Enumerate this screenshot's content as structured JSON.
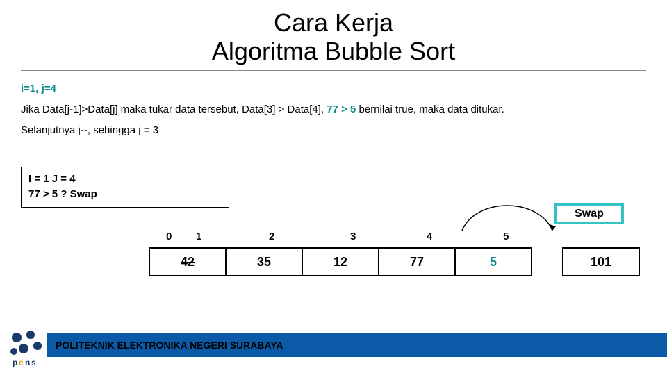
{
  "title_line1": "Cara Kerja",
  "title_line2": "Algoritma Bubble Sort",
  "state_line": "i=1, j=4",
  "explain_prefix": "Jika Data[j-1]>Data[j] maka tukar data tersebut, Data[3] > Data[4], ",
  "explain_highlight": "77 > 5",
  "explain_suffix": " bernilai true, maka data ditukar.",
  "next_line": "Selanjutnya j--, sehingga j = 3",
  "ij_line1": "I = 1 J = 4",
  "ij_line2": "77 > 5 ? Swap",
  "swap_label": "Swap",
  "indices": [
    "0",
    "1",
    "2",
    "3",
    "4",
    "5"
  ],
  "cells": [
    {
      "value": "42",
      "struck": true,
      "teal": false
    },
    {
      "value": "35",
      "struck": false,
      "teal": false
    },
    {
      "value": "12",
      "struck": false,
      "teal": false
    },
    {
      "value": "77",
      "struck": false,
      "teal": false
    },
    {
      "value": "5",
      "struck": false,
      "teal": true
    },
    {
      "value": "101",
      "struck": false,
      "teal": false
    }
  ],
  "footer": "POLITEKNIK ELEKTRONIKA NEGERI SURABAYA",
  "chart_data": {
    "type": "table",
    "title": "Bubble Sort step state",
    "i": 1,
    "j": 4,
    "comparison": "Data[3] > Data[4]",
    "comparison_values": [
      77,
      5
    ],
    "result": "swap",
    "next_j": 3,
    "array_indices": [
      0,
      1,
      2,
      3,
      4,
      5
    ],
    "array_values": [
      42,
      35,
      12,
      77,
      5,
      101
    ],
    "struck_indices": [
      0
    ]
  }
}
